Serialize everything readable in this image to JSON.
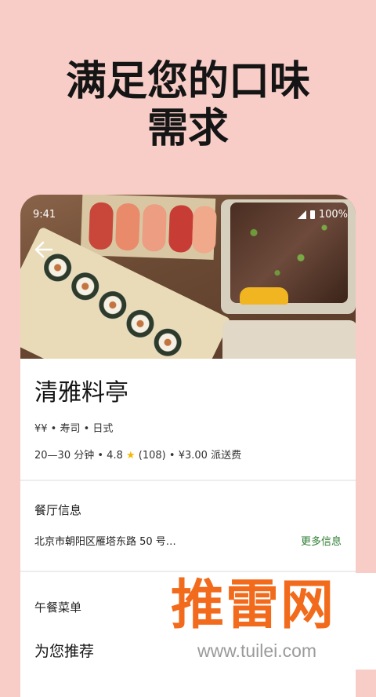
{
  "headline": {
    "line1": "满足您的口味",
    "line2": "需求"
  },
  "status_bar": {
    "time": "9:41",
    "battery": "100%"
  },
  "restaurant": {
    "name": "清雅料亭",
    "tags": "¥¥ • 寿司 • 日式",
    "delivery_time": "20—30 分钟",
    "rating": "4.8",
    "review_count": "(108)",
    "delivery_fee": "¥3.00 派送费"
  },
  "info_section": {
    "title": "餐厅信息",
    "address": "北京市朝阳区雁塔东路 50 号…",
    "more_label": "更多信息"
  },
  "menu_section": {
    "title": "午餐菜单",
    "subtitle": "为您推荐"
  },
  "watermark": {
    "logo": "推雷网",
    "url": "www.tuilei.com"
  },
  "colors": {
    "background": "#f8cdc8",
    "accent_green": "#2e7d32",
    "star": "#f5b800",
    "watermark_orange": "#f26a1b"
  },
  "icons": {
    "back": "arrow-left",
    "rating": "star",
    "signal": "cell-signal",
    "battery": "battery"
  }
}
